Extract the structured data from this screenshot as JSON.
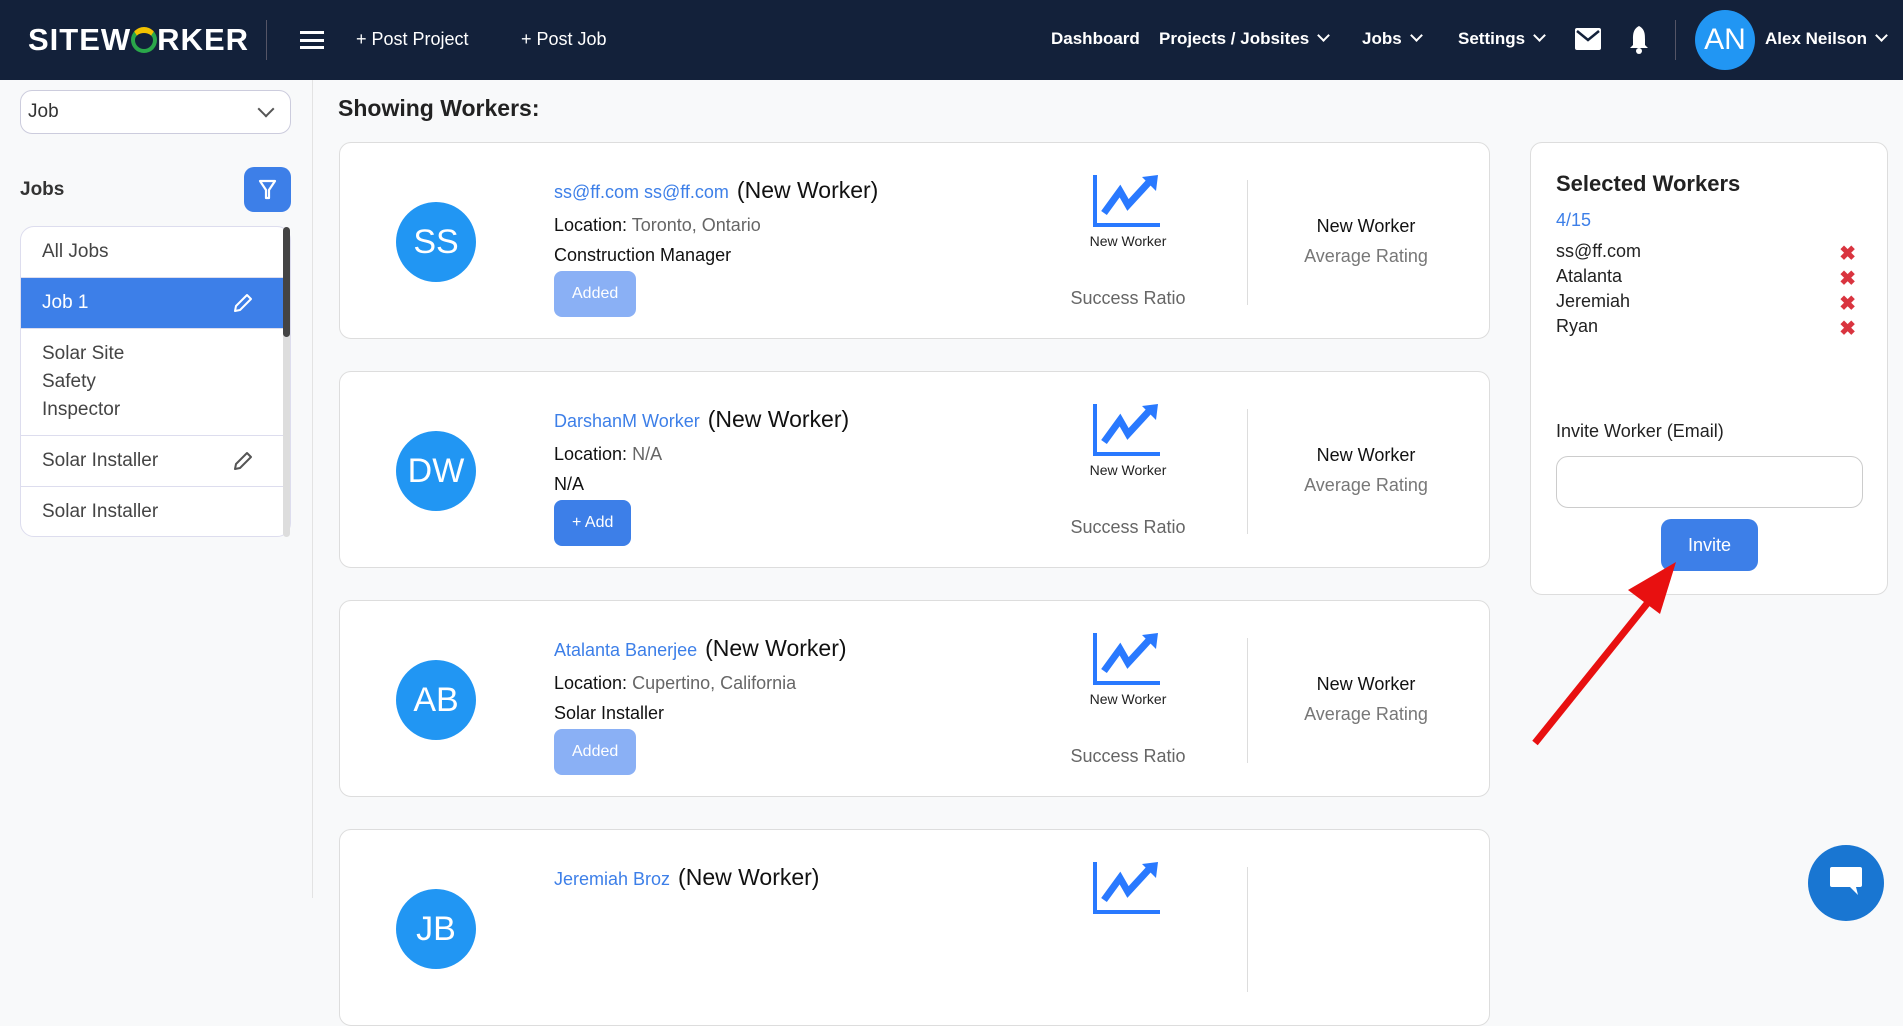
{
  "header": {
    "logo": "SITEWORKER",
    "post_project": "+ Post Project",
    "post_job": "+ Post Job",
    "nav": {
      "dashboard": "Dashboard",
      "projects": "Projects / Jobsites",
      "jobs": "Jobs",
      "settings": "Settings"
    },
    "user": {
      "initials": "AN",
      "name": "Alex Neilson"
    }
  },
  "sidebar": {
    "select_value": "Job",
    "jobs_label": "Jobs",
    "items": [
      {
        "label": "All Jobs"
      },
      {
        "label": "Job 1"
      },
      {
        "label": "Solar Site Safety Inspector"
      },
      {
        "label": "Solar Installer"
      },
      {
        "label": "Solar Installer"
      }
    ]
  },
  "main": {
    "title": "Showing Workers:",
    "workers": [
      {
        "initials": "SS",
        "name": "ss@ff.com ss@ff.com",
        "tag": "(New Worker)",
        "location_label": "Location:",
        "location": "Toronto, Ontario",
        "role": "Construction Manager",
        "button": "Added",
        "success_value": "New Worker",
        "success_label": "Success Ratio",
        "rating_value": "New Worker",
        "rating_label": "Average Rating"
      },
      {
        "initials": "DW",
        "name": "DarshanM Worker",
        "tag": "(New Worker)",
        "location_label": "Location:",
        "location": "N/A",
        "role": "N/A",
        "button": "+ Add",
        "success_value": "New Worker",
        "success_label": "Success Ratio",
        "rating_value": "New Worker",
        "rating_label": "Average Rating"
      },
      {
        "initials": "AB",
        "name": "Atalanta Banerjee",
        "tag": "(New Worker)",
        "location_label": "Location:",
        "location": "Cupertino, California",
        "role": "Solar Installer",
        "button": "Added",
        "success_value": "New Worker",
        "success_label": "Success Ratio",
        "rating_value": "New Worker",
        "rating_label": "Average Rating"
      },
      {
        "initials": "JB",
        "name": "Jeremiah Broz",
        "tag": "(New Worker)"
      }
    ]
  },
  "selected": {
    "title": "Selected Workers",
    "count": "4/15",
    "workers": [
      "ss@ff.com",
      "Atalanta",
      "Jeremiah",
      "Ryan"
    ],
    "invite_label": "Invite Worker (Email)",
    "invite_value": "",
    "invite_button": "Invite"
  },
  "colors": {
    "header_bg": "#13213a",
    "accent": "#3d7fe8",
    "avatar": "#2196f3",
    "remove": "#d9343f",
    "annotation_arrow": "#e81010"
  }
}
